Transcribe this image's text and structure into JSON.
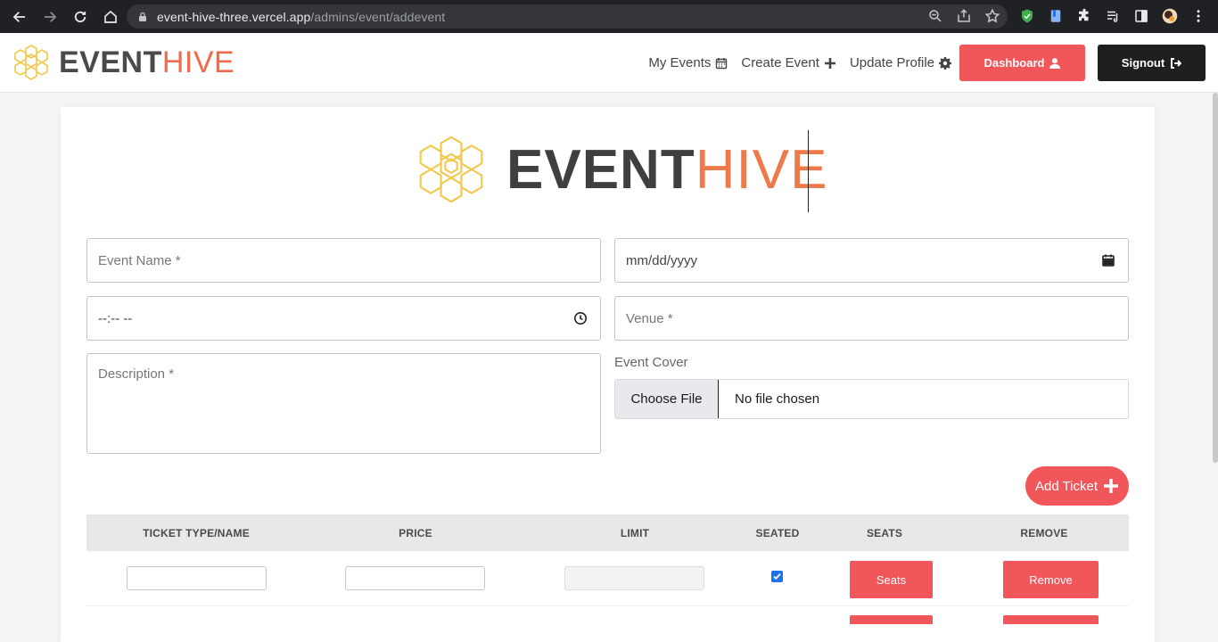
{
  "browser": {
    "url_host": "event-hive-three.vercel.app",
    "url_path": "/admins/event/addevent"
  },
  "brand": {
    "name_bold": "EVENT",
    "name_light": "HIVE"
  },
  "nav": {
    "my_events": "My Events",
    "create_event": "Create Event",
    "update_profile": "Update Profile",
    "dashboard": "Dashboard",
    "signout": "Signout"
  },
  "form": {
    "event_name_placeholder": "Event Name *",
    "date_placeholder": "mm/dd/yyyy",
    "time_placeholder": "--:-- --",
    "venue_placeholder": "Venue *",
    "description_placeholder": "Description *",
    "event_cover_label": "Event Cover",
    "choose_file": "Choose File",
    "no_file": "No file chosen",
    "add_ticket": "Add Ticket"
  },
  "tickets": {
    "headers": [
      "TICKET TYPE/NAME",
      "PRICE",
      "LIMIT",
      "SEATED",
      "SEATS",
      "REMOVE"
    ],
    "row": {
      "seated": true,
      "seats_label": "Seats",
      "remove_label": "Remove"
    }
  },
  "colors": {
    "accent": "#f0565a",
    "dark": "#1f1f1f",
    "hive_orange": "#ee7a4c",
    "hex_yellow": "#f2c84b"
  }
}
